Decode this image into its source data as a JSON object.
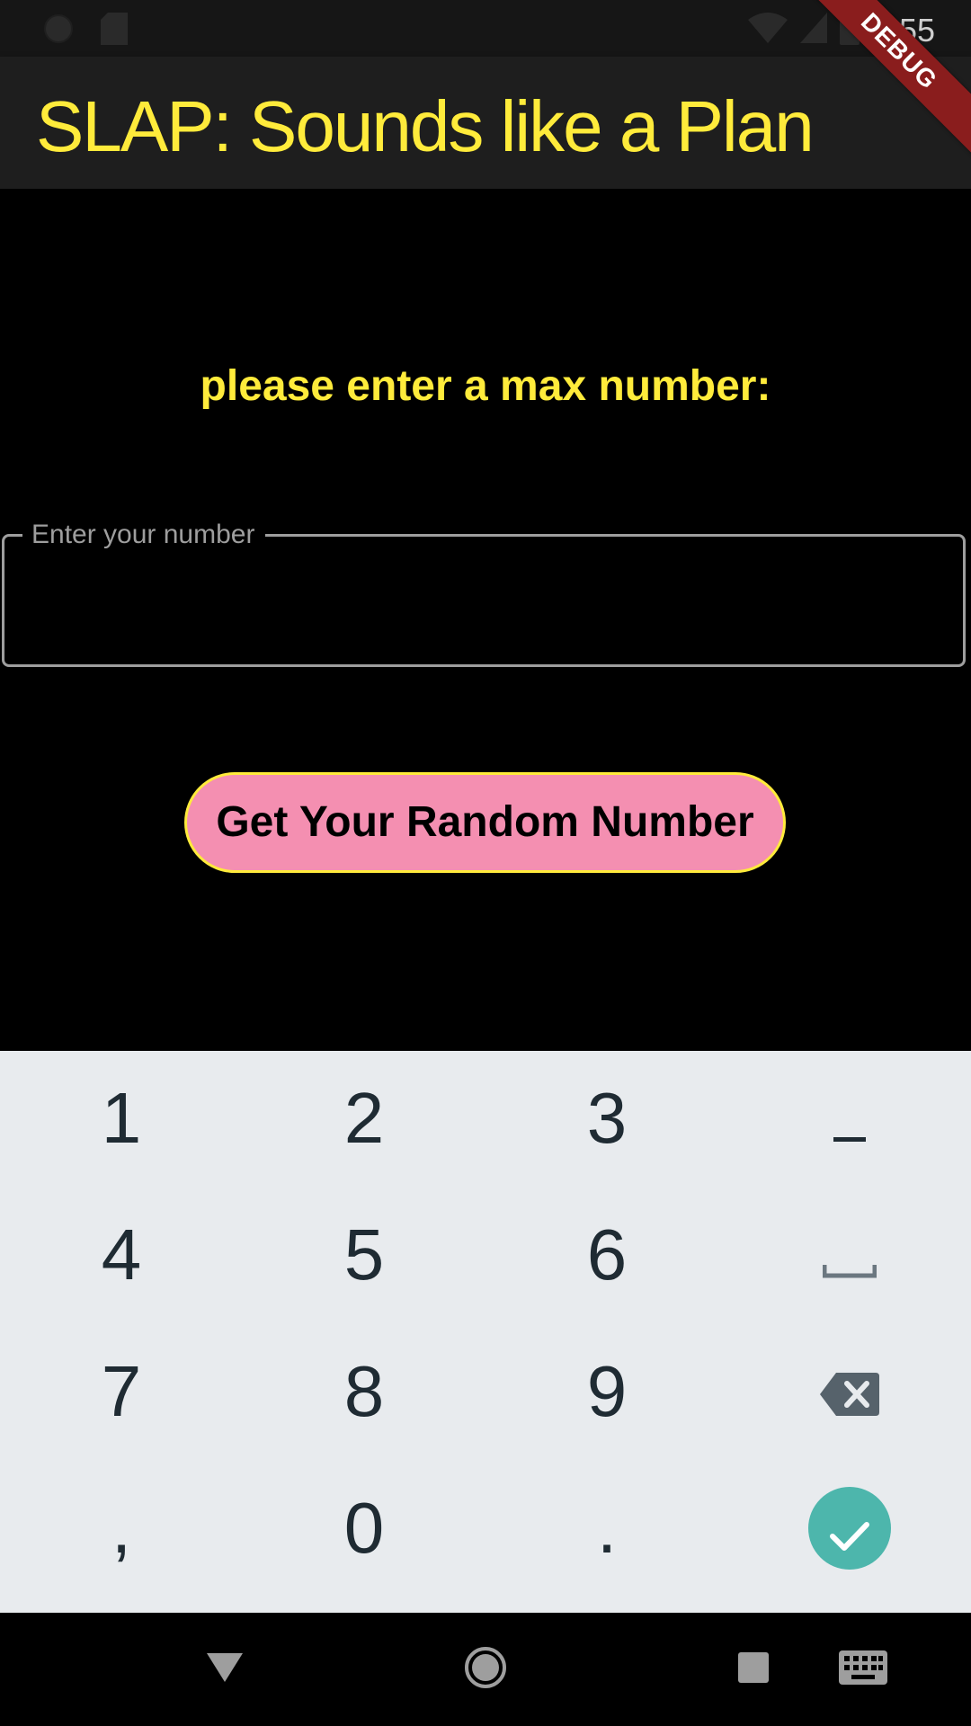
{
  "status_bar": {
    "time": "8:55",
    "left_icons": [
      "circle-status-icon",
      "sd-card-icon"
    ],
    "right_icons": [
      "wifi-icon",
      "cell-signal-icon",
      "battery-icon"
    ]
  },
  "app_bar": {
    "title": "SLAP: Sounds like a Plan",
    "debug_banner": "DEBUG",
    "title_color": "#ffeb3b",
    "banner_color": "#8a1d1d"
  },
  "main": {
    "prompt": "please enter a max number:",
    "input": {
      "label": "Enter your number",
      "value": ""
    },
    "button_label": "Get Your Random Number",
    "button_color": "#f48fb1"
  },
  "keyboard": {
    "rows": [
      [
        "1",
        "2",
        "3",
        "−"
      ],
      [
        "4",
        "5",
        "6",
        "␣"
      ],
      [
        "7",
        "8",
        "9",
        "⌫"
      ],
      [
        ",",
        "0",
        ".",
        "✓"
      ]
    ],
    "special_keys": {
      "minus": "minus-key",
      "space": "space-icon",
      "backspace": "backspace-icon",
      "done": "checkmark-icon"
    },
    "done_color": "#4db6ac"
  },
  "nav_bar": {
    "items": [
      "back-icon",
      "home-icon",
      "recents-icon",
      "keyboard-icon"
    ]
  }
}
